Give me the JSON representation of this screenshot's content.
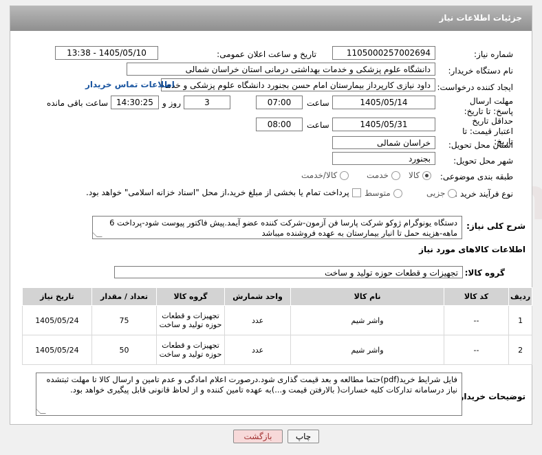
{
  "header": {
    "title": "جزئیات اطلاعات نیاز"
  },
  "labels": {
    "need_number": "شماره نیاز:",
    "announce_datetime": "تاریخ و ساعت اعلان عمومی:",
    "buyer_org": "نام دستگاه خریدار:",
    "requester": "ایجاد کننده درخواست:",
    "reply_deadline": "مهلت ارسال پاسخ: تا تاریخ:",
    "time": "ساعت",
    "day_and": "روز و",
    "remaining": "ساعت باقی مانده",
    "price_validity": "حداقل تاریخ اعتبار قیمت: تا تاریخ:",
    "delivery_province": "استان محل تحویل:",
    "delivery_city": "شهر محل تحویل:",
    "category": "طبقه بندی موضوعی:",
    "purchase_type": "نوع فرآیند خرید :",
    "general_desc": "شرح کلی نیاز:",
    "goods_info": "اطلاعات کالاهای مورد نیاز",
    "goods_group": "گروه کالا:",
    "buyer_notes": "توضیحات خریدار:"
  },
  "fields": {
    "need_number": "1105000257002694",
    "announce_datetime": "1405/05/10 - 13:38",
    "buyer_org": "دانشگاه علوم پزشکی و خدمات بهداشتی درمانی استان خراسان شمالی",
    "requester": "داود نیازی کارپرداز بیمارستان امام حسن بجنورد دانشگاه علوم پزشکی و خدمات",
    "contact_link": "اطلاعات تماس خریدار",
    "reply_date": "1405/05/14",
    "reply_time": "07:00",
    "days": "3",
    "remaining_time": "14:30:25",
    "validity_date": "1405/05/31",
    "validity_time": "08:00",
    "province": "خراسان شمالی",
    "city": "بجنورد"
  },
  "category_options": [
    {
      "label": "کالا",
      "selected": true
    },
    {
      "label": "خدمت",
      "selected": false
    },
    {
      "label": "کالا/خدمت",
      "selected": false
    }
  ],
  "purchase_options": [
    {
      "label": "جزیی",
      "selected": false
    },
    {
      "label": "متوسط",
      "selected": false
    }
  ],
  "payment_note": "پرداخت تمام یا بخشی از مبلغ خرید،از محل \"اسناد خزانه اسلامی\" خواهد بود.",
  "general_description": "دستگاه یونوگرام ژوکو شرکت پارسا فن آزمون-شرکت کننده عضو آیمد.پیش فاکتور پیوست  شود-پرداخت 6 ماهه-هزینه حمل تا انبار بیمارستان به عهده فروشنده میباشد",
  "goods_group_value": "تجهیزات و قطعات حوزه تولید و ساخت",
  "table": {
    "headers": [
      "ردیف",
      "کد کالا",
      "نام کالا",
      "واحد شمارش",
      "گروه کالا",
      "تعداد / مقدار",
      "تاریخ نیاز"
    ],
    "rows": [
      [
        "1",
        "--",
        "واشر شیم",
        "عدد",
        "تجهیزات و قطعات حوزه تولید و ساخت",
        "75",
        "1405/05/24"
      ],
      [
        "2",
        "--",
        "واشر شیم",
        "عدد",
        "تجهیزات و قطعات حوزه تولید و ساخت",
        "50",
        "1405/05/24"
      ]
    ]
  },
  "buyer_notes_text": "فایل شرایط خرید(pdf)حتما مطالعه و بعد قیمت گذاری شود.درصورت اعلام امادگی و عدم تامین و ارسال کالا تا مهلت ثبتشده نیاز درسامانه تدارکات کلیه خسارات( بالارفتن قیمت و...)به عهده تامین کننده و از لحاظ قانونی قابل پیگیری خواهد بود.",
  "buttons": {
    "print": "چاپ",
    "back": "بازگشت"
  },
  "watermark": "AriaTender.net",
  "colors": {
    "header_bg": "#9e9e9e",
    "link": "#1a55a0",
    "back_button_bg": "#f7d9d9"
  }
}
